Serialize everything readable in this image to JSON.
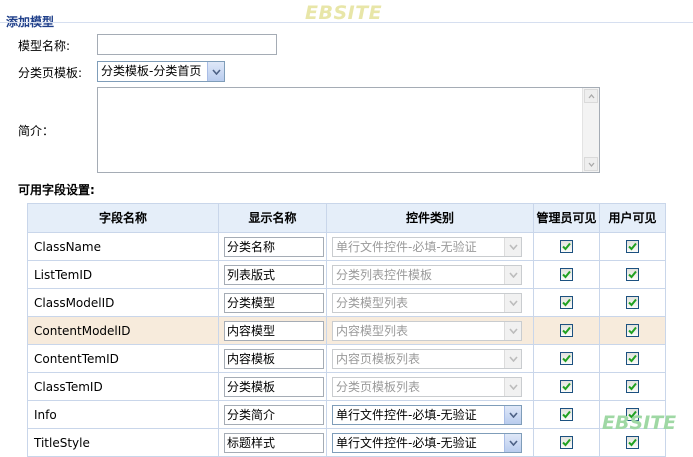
{
  "page": {
    "title": "添加模型",
    "watermark": "EBSITE"
  },
  "form": {
    "model_name_label": "模型名称:",
    "model_name_value": "",
    "class_template_label": "分类页模板:",
    "class_template_value": "分类模板-分类首页",
    "intro_label": "简介：",
    "intro_value": "",
    "fields_label": "可用字段设置:"
  },
  "table": {
    "headers": {
      "field_name": "字段名称",
      "display_name": "显示名称",
      "control_type": "控件类别",
      "admin_visible": "管理员可见",
      "user_visible": "用户可见"
    },
    "rows": [
      {
        "field": "ClassName",
        "display": "分类名称",
        "control": "单行文件控件-必填-无验证",
        "enabled": false,
        "admin": true,
        "user": true,
        "highlight": false
      },
      {
        "field": "ListTemID",
        "display": "列表版式",
        "control": "分类列表控件模板",
        "enabled": false,
        "admin": true,
        "user": true,
        "highlight": false
      },
      {
        "field": "ClassModelID",
        "display": "分类模型",
        "control": "分类模型列表",
        "enabled": false,
        "admin": true,
        "user": true,
        "highlight": false
      },
      {
        "field": "ContentModelID",
        "display": "内容模型",
        "control": "内容模型列表",
        "enabled": false,
        "admin": true,
        "user": true,
        "highlight": true
      },
      {
        "field": "ContentTemID",
        "display": "内容模板",
        "control": "内容页模板列表",
        "enabled": false,
        "admin": true,
        "user": true,
        "highlight": false
      },
      {
        "field": "ClassTemID",
        "display": "分类模板",
        "control": "分类页模板列表",
        "enabled": false,
        "admin": true,
        "user": true,
        "highlight": false
      },
      {
        "field": "Info",
        "display": "分类简介",
        "control": "单行文件控件-必填-无验证",
        "enabled": true,
        "admin": true,
        "user": true,
        "highlight": false
      },
      {
        "field": "TitleStyle",
        "display": "标题样式",
        "control": "单行文件控件-必填-无验证",
        "enabled": true,
        "admin": true,
        "user": true,
        "highlight": false
      }
    ]
  }
}
